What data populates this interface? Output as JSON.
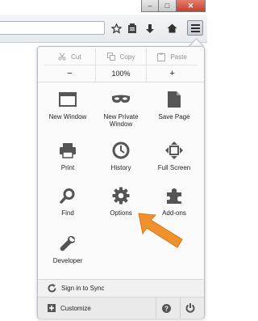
{
  "window": {
    "minimize_glyph": "‒",
    "maximize_glyph": "□",
    "close_glyph": "✕"
  },
  "toolbar": {
    "icons": [
      "bookmark-star-icon",
      "reading-list-icon",
      "download-icon",
      "home-icon"
    ],
    "menu_icon": "hamburger-menu-icon"
  },
  "panel": {
    "edit": {
      "cut": "Cut",
      "copy": "Copy",
      "paste": "Paste"
    },
    "zoom": {
      "minus": "−",
      "level": "100%",
      "plus": "+"
    },
    "items": [
      {
        "label": "New Window",
        "icon": "new-window-icon"
      },
      {
        "label": "New Private Window",
        "icon": "private-mask-icon"
      },
      {
        "label": "Save Page",
        "icon": "save-page-icon"
      },
      {
        "label": "Print",
        "icon": "printer-icon"
      },
      {
        "label": "History",
        "icon": "clock-icon"
      },
      {
        "label": "Full Screen",
        "icon": "fullscreen-icon"
      },
      {
        "label": "Find",
        "icon": "magnifier-icon"
      },
      {
        "label": "Options",
        "icon": "gear-icon"
      },
      {
        "label": "Add-ons",
        "icon": "puzzle-icon"
      },
      {
        "label": "Developer",
        "icon": "wrench-icon"
      }
    ],
    "sync_label": "Sign in to Sync",
    "customize_label": "Customize",
    "help_icon": "help-icon",
    "quit_icon": "power-icon"
  },
  "annotation": {
    "arrow_color": "#f0912d"
  }
}
